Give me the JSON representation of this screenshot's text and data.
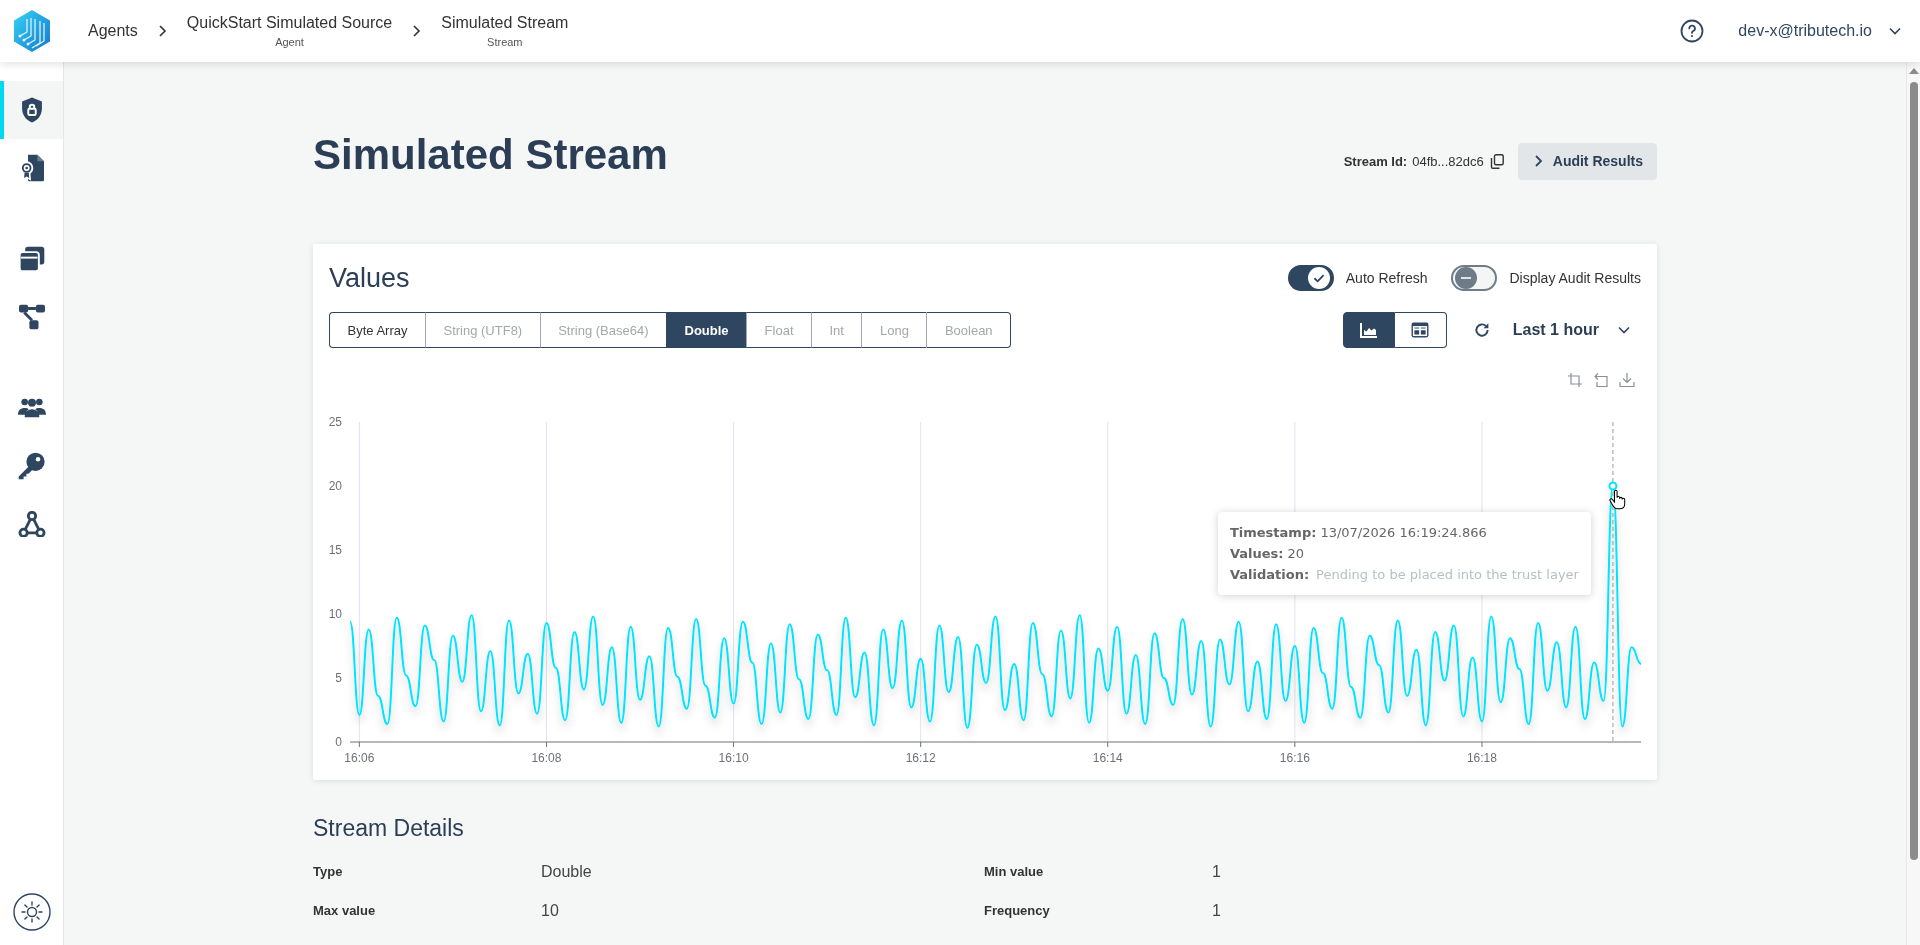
{
  "topbar": {
    "breadcrumbs": [
      {
        "label": "Agents"
      },
      {
        "label": "QuickStart Simulated Source",
        "sublabel": "Agent"
      },
      {
        "label": "Simulated Stream",
        "sublabel": "Stream"
      }
    ],
    "user": "dev-x@tributech.io"
  },
  "sidebar": {
    "groups": [
      {
        "items": [
          {
            "selected": true
          },
          {
            "selected": false
          }
        ]
      },
      {
        "items": [
          {
            "selected": false
          },
          {
            "selected": false
          }
        ]
      },
      {
        "items": [
          {
            "selected": false
          },
          {
            "selected": false
          },
          {
            "selected": false
          }
        ]
      }
    ]
  },
  "page": {
    "title": "Simulated Stream",
    "stream_id": {
      "label": "Stream Id:",
      "value": "04fb...82dc6"
    },
    "audit_button": "Audit Results"
  },
  "values_card": {
    "title": "Values",
    "toggles": [
      {
        "label": "Auto Refresh",
        "on": true
      },
      {
        "label": "Display Audit Results",
        "on": false
      }
    ],
    "types": [
      {
        "label": "Byte Array",
        "selected": false,
        "disabled": false
      },
      {
        "label": "String (UTF8)",
        "selected": false,
        "disabled": true
      },
      {
        "label": "String (Base64)",
        "selected": false,
        "disabled": true
      },
      {
        "label": "Double",
        "selected": true,
        "disabled": false
      },
      {
        "label": "Float",
        "selected": false,
        "disabled": true
      },
      {
        "label": "Int",
        "selected": false,
        "disabled": true
      },
      {
        "label": "Long",
        "selected": false,
        "disabled": true
      },
      {
        "label": "Boolean",
        "selected": false,
        "disabled": true
      }
    ],
    "views": [
      {
        "selected": true
      },
      {
        "selected": false
      }
    ],
    "range": "Last 1 hour",
    "chart_data": {
      "type": "line",
      "categories": [
        null,
        "16:06",
        null,
        null,
        null,
        null,
        null,
        null,
        null,
        null,
        null,
        null,
        null,
        null,
        null,
        null,
        null,
        null,
        null,
        null,
        null,
        "16:08",
        null,
        null,
        null,
        null,
        null,
        null,
        null,
        null,
        null,
        null,
        null,
        null,
        null,
        null,
        null,
        null,
        null,
        null,
        null,
        "16:10",
        null,
        null,
        null,
        null,
        null,
        null,
        null,
        null,
        null,
        null,
        null,
        null,
        null,
        null,
        null,
        null,
        null,
        null,
        null,
        "16:12",
        null,
        null,
        null,
        null,
        null,
        null,
        null,
        null,
        null,
        null,
        null,
        null,
        null,
        null,
        null,
        null,
        null,
        null,
        null,
        "16:14",
        null,
        null,
        null,
        null,
        null,
        null,
        null,
        null,
        null,
        null,
        null,
        null,
        null,
        null,
        null,
        null,
        null,
        null,
        null,
        "16:16",
        null,
        null,
        null,
        null,
        null,
        null,
        null,
        null,
        null,
        null,
        null,
        null,
        null,
        null,
        null,
        null,
        null,
        null,
        null,
        "16:18",
        null,
        null,
        null,
        null,
        null,
        null,
        null,
        null,
        null,
        null,
        null,
        null,
        null,
        null,
        null,
        null,
        null
      ],
      "series": [
        {
          "color": "#00e5ff",
          "values": [
            9.4,
            2.1,
            8.8,
            3.6,
            1.4,
            9.7,
            5.2,
            2.8,
            9.1,
            6.4,
            1.6,
            8.3,
            4.7,
            9.9,
            2.4,
            7.1,
            1.3,
            9.5,
            3.8,
            6.9,
            2.2,
            9.3,
            5.8,
            1.7,
            8.6,
            4.1,
            9.8,
            2.9,
            7.4,
            1.5,
            9.0,
            3.3,
            6.7,
            1.2,
            8.9,
            5.1,
            2.6,
            9.6,
            4.4,
            1.9,
            8.1,
            3.0,
            9.4,
            6.2,
            1.4,
            7.7,
            2.3,
            9.2,
            4.9,
            1.8,
            8.4,
            5.6,
            2.1,
            9.7,
            3.5,
            7.0,
            1.3,
            8.8,
            4.2,
            9.5,
            2.7,
            6.5,
            1.6,
            9.1,
            3.9,
            8.2,
            1.1,
            7.6,
            4.6,
            9.8,
            2.5,
            6.1,
            1.7,
            9.3,
            5.3,
            2.0,
            8.7,
            3.4,
            9.9,
            1.5,
            7.3,
            4.0,
            9.0,
            2.2,
            6.8,
            1.4,
            8.5,
            5.0,
            2.9,
            9.6,
            3.7,
            7.9,
            1.2,
            8.0,
            4.5,
            9.4,
            2.4,
            6.3,
            1.8,
            9.2,
            3.2,
            7.5,
            1.5,
            8.9,
            5.4,
            2.6,
            9.7,
            4.3,
            1.9,
            8.3,
            6.0,
            2.3,
            9.5,
            3.6,
            7.2,
            1.3,
            8.6,
            4.8,
            9.1,
            2.0,
            6.6,
            1.6,
            9.8,
            3.1,
            8.1,
            5.7,
            1.4,
            9.3,
            4.0,
            7.8,
            2.7,
            9.0,
            1.8,
            6.2,
            3.2,
            20,
            1.2,
            7.4,
            6.1
          ]
        }
      ],
      "ylim": [
        0,
        25
      ],
      "yticks": [
        0,
        5,
        10,
        15,
        20,
        25
      ]
    },
    "tooltip": {
      "lines": [
        {
          "label": "Timestamp:",
          "value": "13/07/2026 16:19:24.866",
          "muted": false
        },
        {
          "label": "Values:",
          "value": "20",
          "muted": false
        },
        {
          "label": "Validation:",
          "value": "Pending to be placed into the trust layer",
          "muted": true
        }
      ]
    }
  },
  "stream_details": {
    "title": "Stream Details",
    "fields": [
      {
        "label": "Type",
        "value": "Double"
      },
      {
        "label": "Min value",
        "value": "1"
      },
      {
        "label": "Max value",
        "value": "10"
      },
      {
        "label": "Frequency",
        "value": "1"
      }
    ]
  }
}
